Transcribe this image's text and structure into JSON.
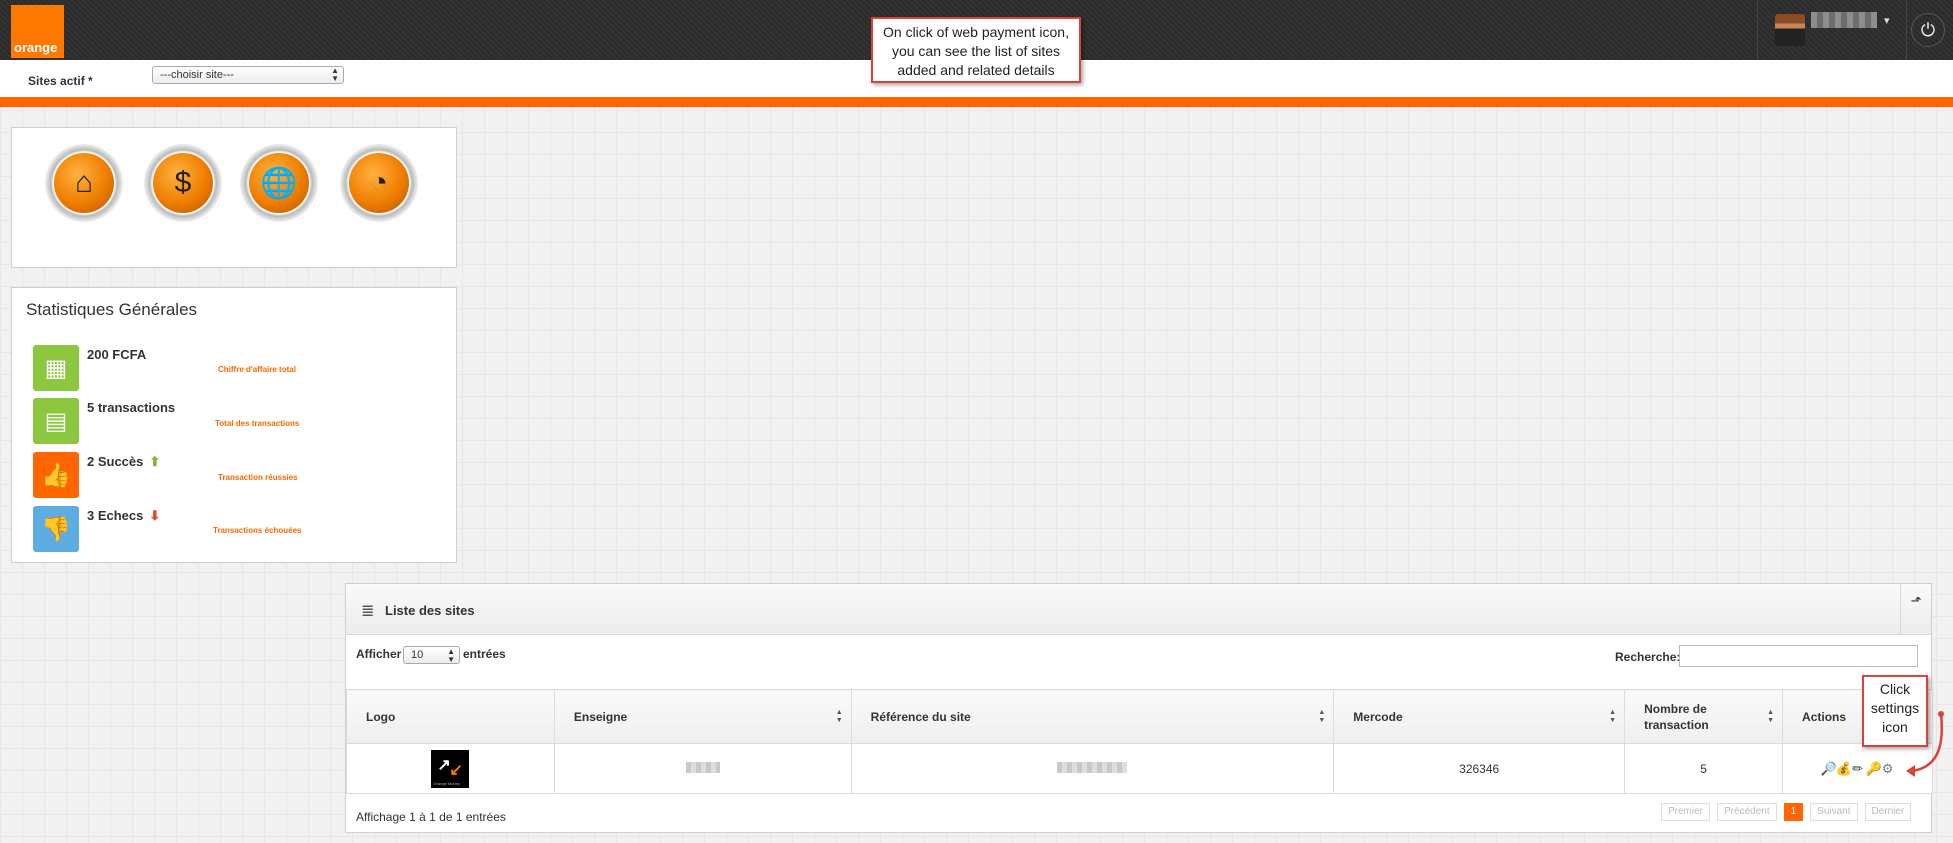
{
  "header": {
    "logo_text": "orange",
    "user_name_redacted": "",
    "user_caret": "▾",
    "power_glyph": "⏻"
  },
  "annotations": {
    "top_callout": {
      "line1": "On click of web payment icon,",
      "line2": "you can see the list of sites",
      "line3": "added and related details"
    },
    "settings_callout": {
      "line1": "Click",
      "line2": "settings",
      "line3": "icon"
    },
    "accent_color": "#d9433a"
  },
  "site_bar": {
    "label": "Sites actif *",
    "select_value": "---choisir site---"
  },
  "nav_icons": [
    {
      "name": "home-icon",
      "glyph": "⌂"
    },
    {
      "name": "money-icon",
      "glyph": "$"
    },
    {
      "name": "web-payment-icon",
      "glyph": "🌐"
    },
    {
      "name": "statistics-icon",
      "glyph": "◔"
    }
  ],
  "stats": {
    "title": "Statistiques Générales",
    "items": [
      {
        "value": "200 FCFA",
        "label": "Chiffre d'affaire total",
        "color": "#8dc63f",
        "icon": "cash-icon"
      },
      {
        "value": "5 transactions",
        "label": "Total des transactions",
        "color": "#8dc63f",
        "icon": "calculator-icon"
      },
      {
        "value": "2 Succès",
        "label": "Transaction réussies",
        "color": "#ff6600",
        "icon": "thumbs-up-icon"
      },
      {
        "value": "3 Echecs",
        "label": "Transactions échouées",
        "color": "#5dade2",
        "icon": "thumbs-down-icon"
      }
    ]
  },
  "sites_list": {
    "title": "Liste des sites",
    "length_label": "Afficher",
    "length_value": "10",
    "entries_label": "entrées",
    "search_label": "Recherche:",
    "columns": [
      "Logo",
      "Enseigne",
      "Référence du site",
      "Mercode",
      "Nombre de transaction",
      "Actions"
    ],
    "rows": [
      {
        "logo_caption": "Orange Money",
        "enseigne": "",
        "reference": "",
        "mercode": "326346",
        "transactions": "5"
      }
    ],
    "info": "Affichage 1 à 1 de 1 entrées",
    "pager": {
      "first": "Premier",
      "previous": "Précédent",
      "current": "1",
      "next": "Suivant",
      "last": "Dernier"
    }
  },
  "colors": {
    "brand_orange": "#ff6600",
    "topbar": "#2f2f2f"
  }
}
